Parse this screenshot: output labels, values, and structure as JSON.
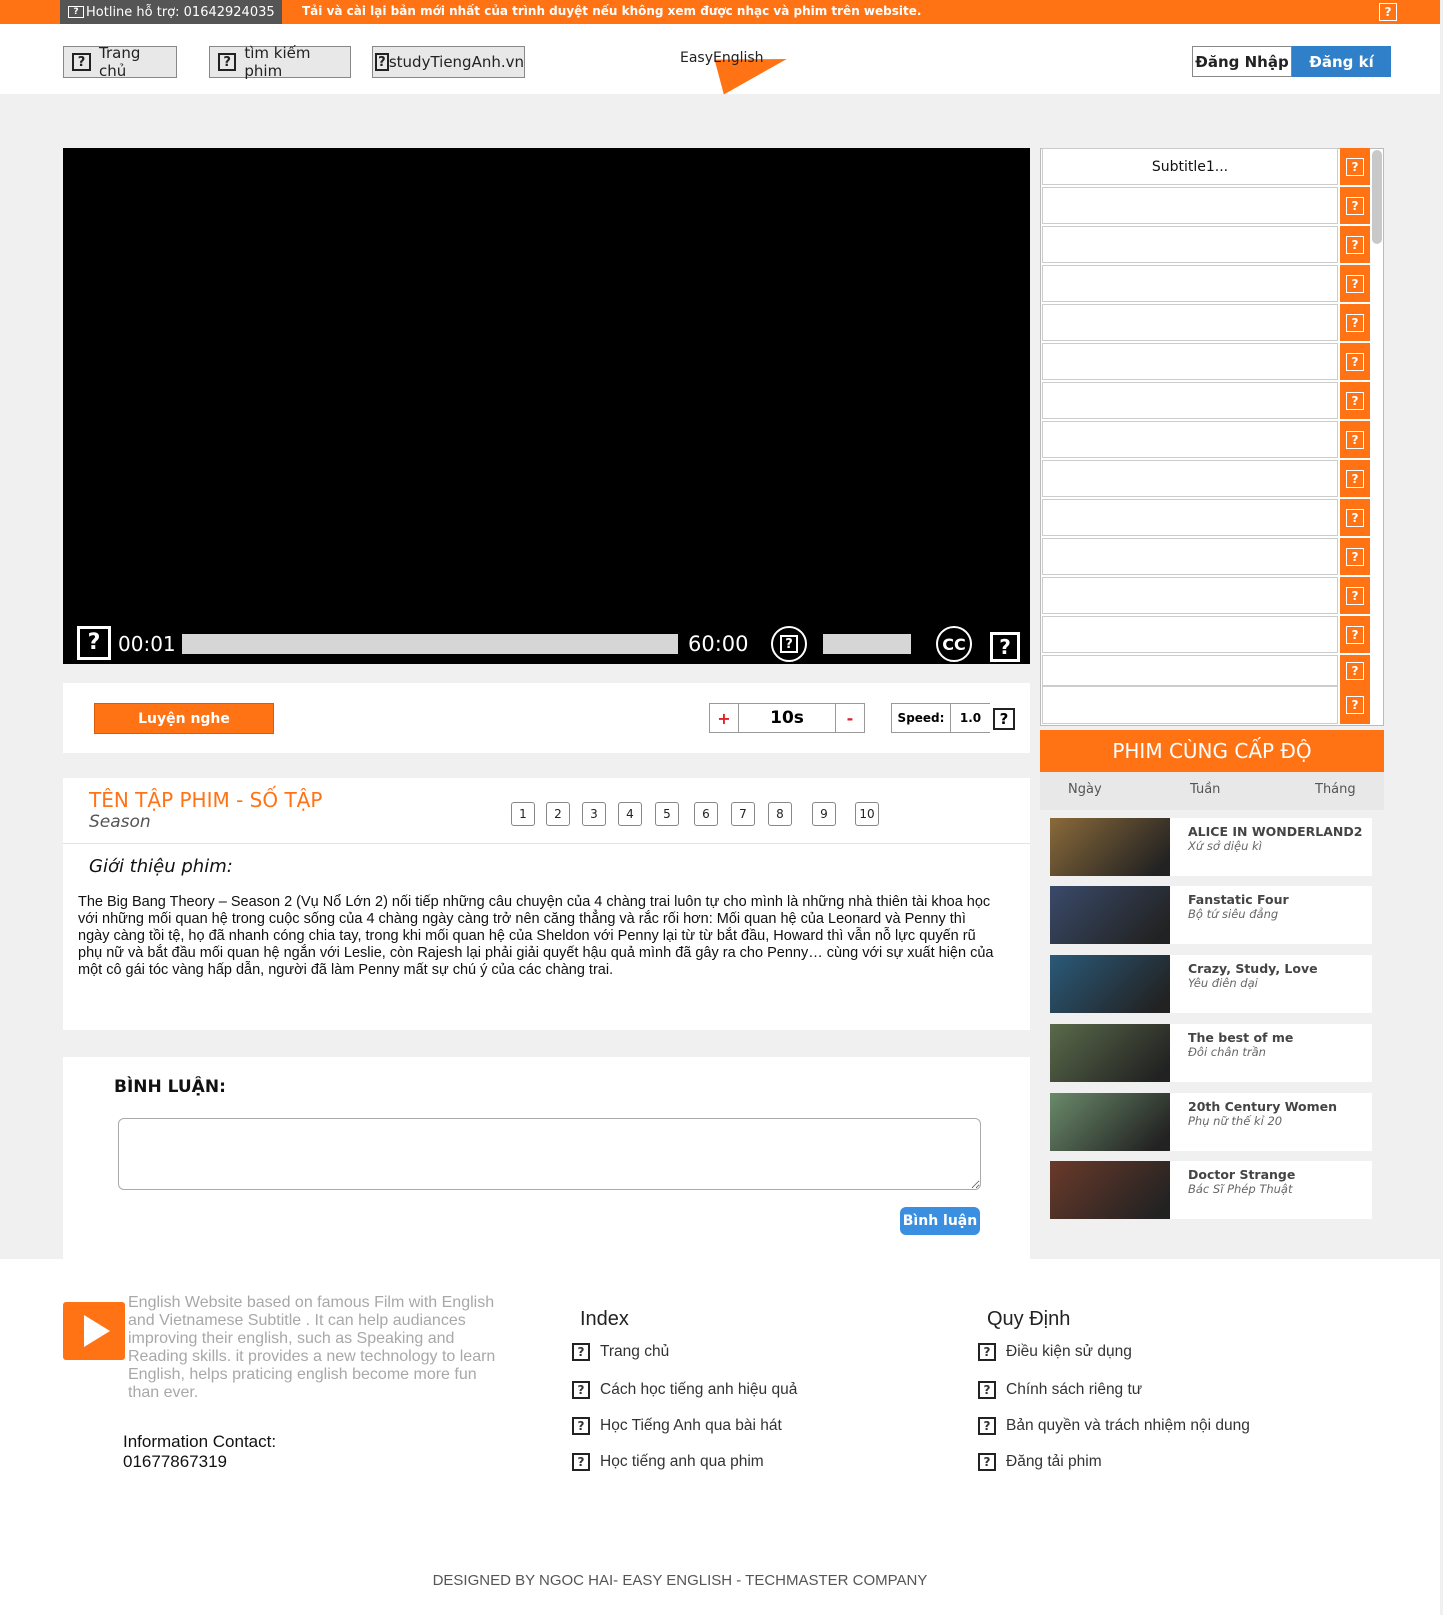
{
  "topbar": {
    "hotline": "Hotline hỗ trợ: 01642924035",
    "notice": "Tải và cài lại bản mới nhất của trình duyệt nếu không xem được nhạc và phim trên website."
  },
  "nav": {
    "home": "Trang chủ",
    "search": "tìm kiếm phim",
    "site": "studyTiengAnh.vn"
  },
  "logo": {
    "text": "EasyEnglish"
  },
  "auth": {
    "login": "Đăng Nhập",
    "register": "Đăng kí"
  },
  "player": {
    "current_time": "00:01",
    "duration": "60:00",
    "progress": 0,
    "cc_label": "CC"
  },
  "subtitles": {
    "first": "Subtitle1...",
    "rows": [
      "Subtitle1...",
      "",
      "",
      "",
      "",
      "",
      "",
      "",
      "",
      "",
      "",
      "",
      "",
      "",
      ""
    ]
  },
  "practice": {
    "button": "Luyện nghe",
    "plus": "+",
    "seek": "10s",
    "minus": "-",
    "speed_label": "Speed:",
    "speed_value": "1.0"
  },
  "episode": {
    "title": "TÊN TẬP PHIM - SỐ TẬP",
    "season": "Season",
    "numbers": [
      "1",
      "2",
      "3",
      "4",
      "5",
      "6",
      "7",
      "8",
      "9",
      "10"
    ],
    "intro_label": "Giới thiệu phim:",
    "intro_text": "The Big Bang Theory – Season 2 (Vụ Nổ Lớn 2) nối tiếp những câu chuyện của 4 chàng trai luôn tự cho mình là những nhà thiên tài khoa học với những mối quan hệ trong cuộc sống của 4 chàng ngày càng trở nên căng thẳng và rắc rối hơn: Mối quan hệ của Leonard và Penny thì ngày càng tồi tệ, họ đã nhanh cóng chia tay, trong khi mối quan hệ của Sheldon với Penny lại từ từ bắt đầu, Howard thì vẫn nỗ lực quyến rũ phụ nữ và bắt đầu mối quan hệ ngắn với Leslie, còn Rajesh lại phải giải quyết hậu quả mình đã gây ra cho Penny… cùng với sự xuất hiện của một cô gái tóc vàng hấp dẫn, người đã làm Penny mất sự chú ý của các chàng trai."
  },
  "comment": {
    "label": "BÌNH LUẬN:",
    "placeholder": "",
    "button": "Bình luận"
  },
  "ranking": {
    "title": "PHIM CÙNG CẤP ĐỘ",
    "tabs": [
      "Ngày",
      "Tuần",
      "Tháng"
    ],
    "items": [
      {
        "name": "ALICE IN WONDERLAND2",
        "sub": "Xứ sở diệu kì",
        "color": "#8a6a3a"
      },
      {
        "name": "Fanstatic Four",
        "sub": "Bộ tứ siêu đẳng",
        "color": "#3a4a6a"
      },
      {
        "name": "Crazy, Study, Love",
        "sub": "Yêu điên dại",
        "color": "#2a5a7a"
      },
      {
        "name": "The best of me",
        "sub": "Đôi chân trần",
        "color": "#5a6a4a"
      },
      {
        "name": "20th Century Women",
        "sub": "Phụ nữ thế kỉ 20",
        "color": "#6a8a6a"
      },
      {
        "name": "Doctor Strange",
        "sub": "Bác Sĩ Phép Thuật",
        "color": "#6a3a2a"
      }
    ]
  },
  "footer": {
    "description": "English Website based on  famous Film with English and Vietnamese Subtitle . It can help audiances improving their english, such as Speaking and Reading skills. it provides a new technology to learn English, helps praticing english become more fun than ever.",
    "contact_label": "Information Contact:",
    "contact_phone": "01677867319",
    "index_title": "Index",
    "index_links": [
      "Trang chủ",
      "Cách học tiếng anh hiệu quả",
      "Học Tiếng Anh qua bài hát",
      "Học tiếng anh qua phim"
    ],
    "rules_title": "Quy Định",
    "rules_links": [
      "Điều kiện sử dụng",
      "Chính sách riêng tư",
      "Bản quyền và trách nhiệm nội dung",
      "Đăng tải phim"
    ],
    "copyright": "DESIGNED BY NGOC HAI- EASY ENGLISH - TECHMASTER COMPANY"
  },
  "colors": {
    "accent": "#ff7315",
    "primary_blue": "#2f80c8"
  }
}
